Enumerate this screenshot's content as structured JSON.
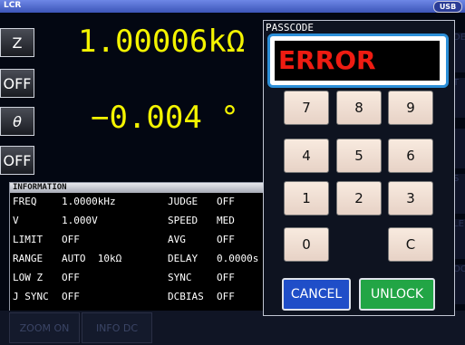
{
  "app": {
    "title": "LCR",
    "usb_badge": "USB"
  },
  "params": [
    {
      "label": "Z",
      "value": "1.00006kΩ"
    },
    {
      "label": "OFF"
    },
    {
      "label": "θ",
      "value": "−0.004 °"
    },
    {
      "label": "OFF"
    }
  ],
  "info": {
    "header": "INFORMATION",
    "left": [
      [
        "FREQ",
        "1.0000kHz"
      ],
      [
        "V",
        "1.000V"
      ],
      [
        "LIMIT",
        "OFF"
      ],
      [
        "RANGE",
        "AUTO  10kΩ"
      ],
      [
        "LOW Z",
        "OFF"
      ],
      [
        "J SYNC",
        "OFF"
      ]
    ],
    "right": [
      [
        "JUDGE",
        "OFF"
      ],
      [
        "SPEED",
        "MED"
      ],
      [
        "AVG",
        "OFF"
      ],
      [
        "DELAY",
        "0.0000s"
      ],
      [
        "SYNC",
        "OFF"
      ],
      [
        "DCBIAS",
        "OFF"
      ]
    ]
  },
  "bottom": {
    "zoom": "ZOOM ON",
    "info_dc": "INFO DC"
  },
  "right_tabs": [
    "DE",
    "T",
    "J",
    "S",
    "LE",
    "OCK"
  ],
  "passcode": {
    "title": "PASSCODE",
    "display": "ERROR",
    "keys": [
      "7",
      "8",
      "9",
      "4",
      "5",
      "6",
      "1",
      "2",
      "3",
      "0",
      "C"
    ],
    "cancel": "CANCEL",
    "unlock": "UNLOCK"
  },
  "colors": {
    "value": "#f4f400",
    "error": "#ee1c12",
    "cancel": "#1f4ec8",
    "unlock": "#22a545",
    "frame": "#2c8fd8"
  }
}
